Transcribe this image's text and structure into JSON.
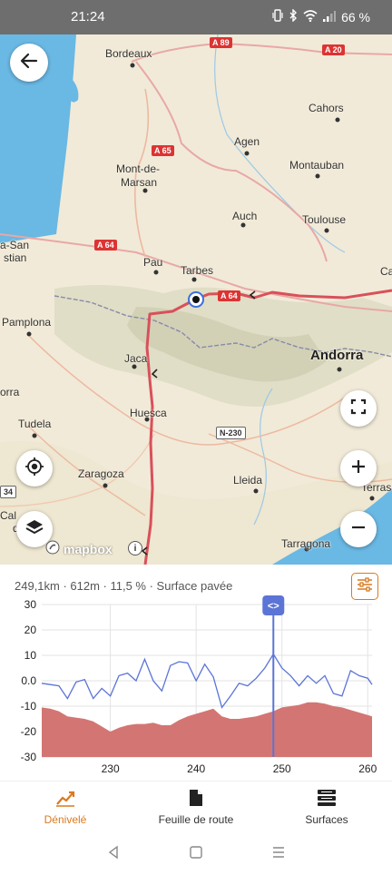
{
  "status_bar": {
    "time": "21:24",
    "battery": "66 %",
    "icons": [
      "vibrate-icon",
      "bluetooth-icon",
      "wifi-icon",
      "signal-icon"
    ]
  },
  "map": {
    "labels": [
      {
        "text": "Bordeaux",
        "name": "map-label-bordeaux"
      },
      {
        "text": "Cahors",
        "name": "map-label-cahors"
      },
      {
        "text": "Agen",
        "name": "map-label-agen"
      },
      {
        "text": "Mont-de-",
        "name": "map-label-montdemarsan-1"
      },
      {
        "text": "Marsan",
        "name": "map-label-montdemarsan-2"
      },
      {
        "text": "Montauban",
        "name": "map-label-montauban"
      },
      {
        "text": "Auch",
        "name": "map-label-auch"
      },
      {
        "text": "Toulouse",
        "name": "map-label-toulouse"
      },
      {
        "text": "a-San",
        "name": "map-label-sansebastian-1"
      },
      {
        "text": "stian",
        "name": "map-label-sansebastian-2"
      },
      {
        "text": "Pau",
        "name": "map-label-pau"
      },
      {
        "text": "Tarbes",
        "name": "map-label-tarbes"
      },
      {
        "text": "Ca",
        "name": "map-label-carcassonne"
      },
      {
        "text": "Pamplona",
        "name": "map-label-pamplona"
      },
      {
        "text": "Jaca",
        "name": "map-label-jaca"
      },
      {
        "text": "Andorra",
        "name": "map-label-andorra"
      },
      {
        "text": "orra",
        "name": "map-label-andorra-edge"
      },
      {
        "text": "Huesca",
        "name": "map-label-huesca"
      },
      {
        "text": "Tudela",
        "name": "map-label-tudela"
      },
      {
        "text": "Zaragoza",
        "name": "map-label-zaragoza"
      },
      {
        "text": "Lleida",
        "name": "map-label-lleida"
      },
      {
        "text": "Terras",
        "name": "map-label-terrassa"
      },
      {
        "text": "Cal",
        "name": "map-label-calatayud-1"
      },
      {
        "text": "d",
        "name": "map-label-calatayud-2"
      },
      {
        "text": "Tarragona",
        "name": "map-label-tarragona"
      }
    ],
    "shields": [
      {
        "text": "A 89",
        "name": "road-a89"
      },
      {
        "text": "A 20",
        "name": "road-a20"
      },
      {
        "text": "A 65",
        "name": "road-a65"
      },
      {
        "text": "A 64",
        "name": "road-a64-west"
      },
      {
        "text": "A 64",
        "name": "road-a64-east"
      },
      {
        "text": "N-230",
        "name": "road-n230"
      },
      {
        "text": "34",
        "name": "road-34"
      }
    ],
    "attribution": "mapbox",
    "attribution_info": "i"
  },
  "stats": {
    "summary": "249,1km · 612m · 11,5 % · Surface pavée"
  },
  "chart_data": {
    "type": "line",
    "x": [
      222,
      223,
      224,
      225,
      226,
      227,
      228,
      229,
      230,
      231,
      232,
      233,
      234,
      235,
      236,
      237,
      238,
      239,
      240,
      241,
      242,
      243,
      244,
      245,
      246,
      247,
      248,
      249,
      250,
      251,
      252,
      253,
      254,
      255,
      256,
      257,
      258,
      259,
      260,
      260.5
    ],
    "series": [
      {
        "values": [
          -1,
          -1.5,
          -2,
          -7,
          -0.5,
          0.5,
          -7,
          -3,
          -6,
          2,
          3,
          0,
          8.5,
          0,
          -4,
          6,
          7.5,
          7,
          0,
          6.5,
          1.5,
          -10.5,
          -6,
          -1,
          -2,
          1,
          5,
          10.5,
          5,
          2,
          -2,
          2,
          -1,
          2,
          -5,
          -6,
          4,
          2,
          1,
          -1.5
        ]
      },
      {
        "values": [
          -10.5,
          -11,
          -12,
          -14,
          -14.5,
          -15,
          -16,
          -18,
          -20,
          -18.5,
          -17.5,
          -17,
          -17,
          -16.5,
          -17.5,
          -17.5,
          -15.5,
          -14,
          -13,
          -12,
          -11,
          -14,
          -15,
          -15,
          -14.5,
          -14,
          -13,
          -12,
          -10.5,
          -10,
          -9.5,
          -8.5,
          -8.5,
          -9,
          -10,
          -10.5,
          -11.5,
          -12.5,
          -13.5,
          -14
        ]
      }
    ],
    "xticks": [
      "230",
      "240",
      "250",
      "260"
    ],
    "yticks": [
      "30",
      "20",
      "10",
      "0.0",
      "-10",
      "-20",
      "-30"
    ],
    "xlim": [
      222,
      260.5
    ],
    "ylim": [
      -30,
      30
    ],
    "cursor_x": 249,
    "cursor_label": "<>",
    "colors": {
      "line": "#5b74d6",
      "area": "#d37673",
      "cursor": "#5b74d6"
    }
  },
  "tabs": [
    {
      "label": "Dénivelé",
      "icon": "elevation-icon",
      "active": true
    },
    {
      "label": "Feuille de route",
      "icon": "document-icon",
      "active": false
    },
    {
      "label": "Surfaces",
      "icon": "surfaces-icon",
      "active": false
    }
  ],
  "nav": [
    "back-nav",
    "home-nav",
    "recents-nav"
  ],
  "colors": {
    "accent": "#d97a1e",
    "route": "#d9505a",
    "water": "#6ab8e4"
  }
}
